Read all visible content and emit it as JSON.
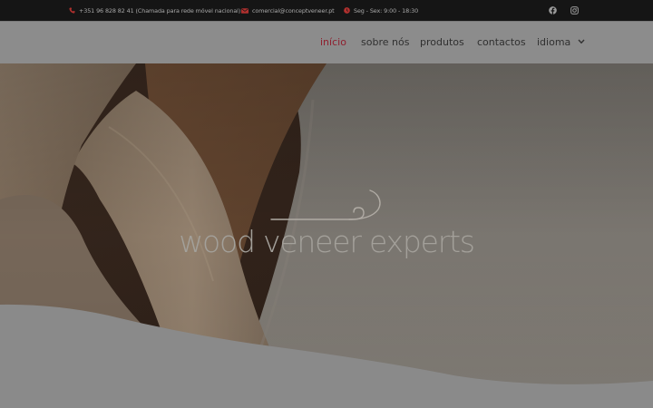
{
  "topbar": {
    "phone": "+351 96 828 82 41 (Chamada para rede móvel nacional)",
    "email": "comercial@conceptveneer.pt",
    "hours": "Seg - Sex: 9:00 - 18:30",
    "phone_icon": "phone-icon",
    "email_icon": "envelope-icon",
    "hours_icon": "clock-icon",
    "social": [
      "facebook-icon",
      "instagram-icon"
    ]
  },
  "nav": {
    "items": [
      {
        "label": "início",
        "active": true
      },
      {
        "label": "sobre nós",
        "active": false
      },
      {
        "label": "produtos",
        "active": false
      },
      {
        "label": "contactos",
        "active": false
      },
      {
        "label": "idioma",
        "active": false,
        "has_dropdown": true
      }
    ]
  },
  "hero": {
    "title": "wood veneer experts"
  },
  "colors": {
    "topbar_bg": "#151515",
    "header_bg": "#8c8c8c",
    "accent": "#8f1f2e",
    "icon_red": "#b0302e"
  }
}
